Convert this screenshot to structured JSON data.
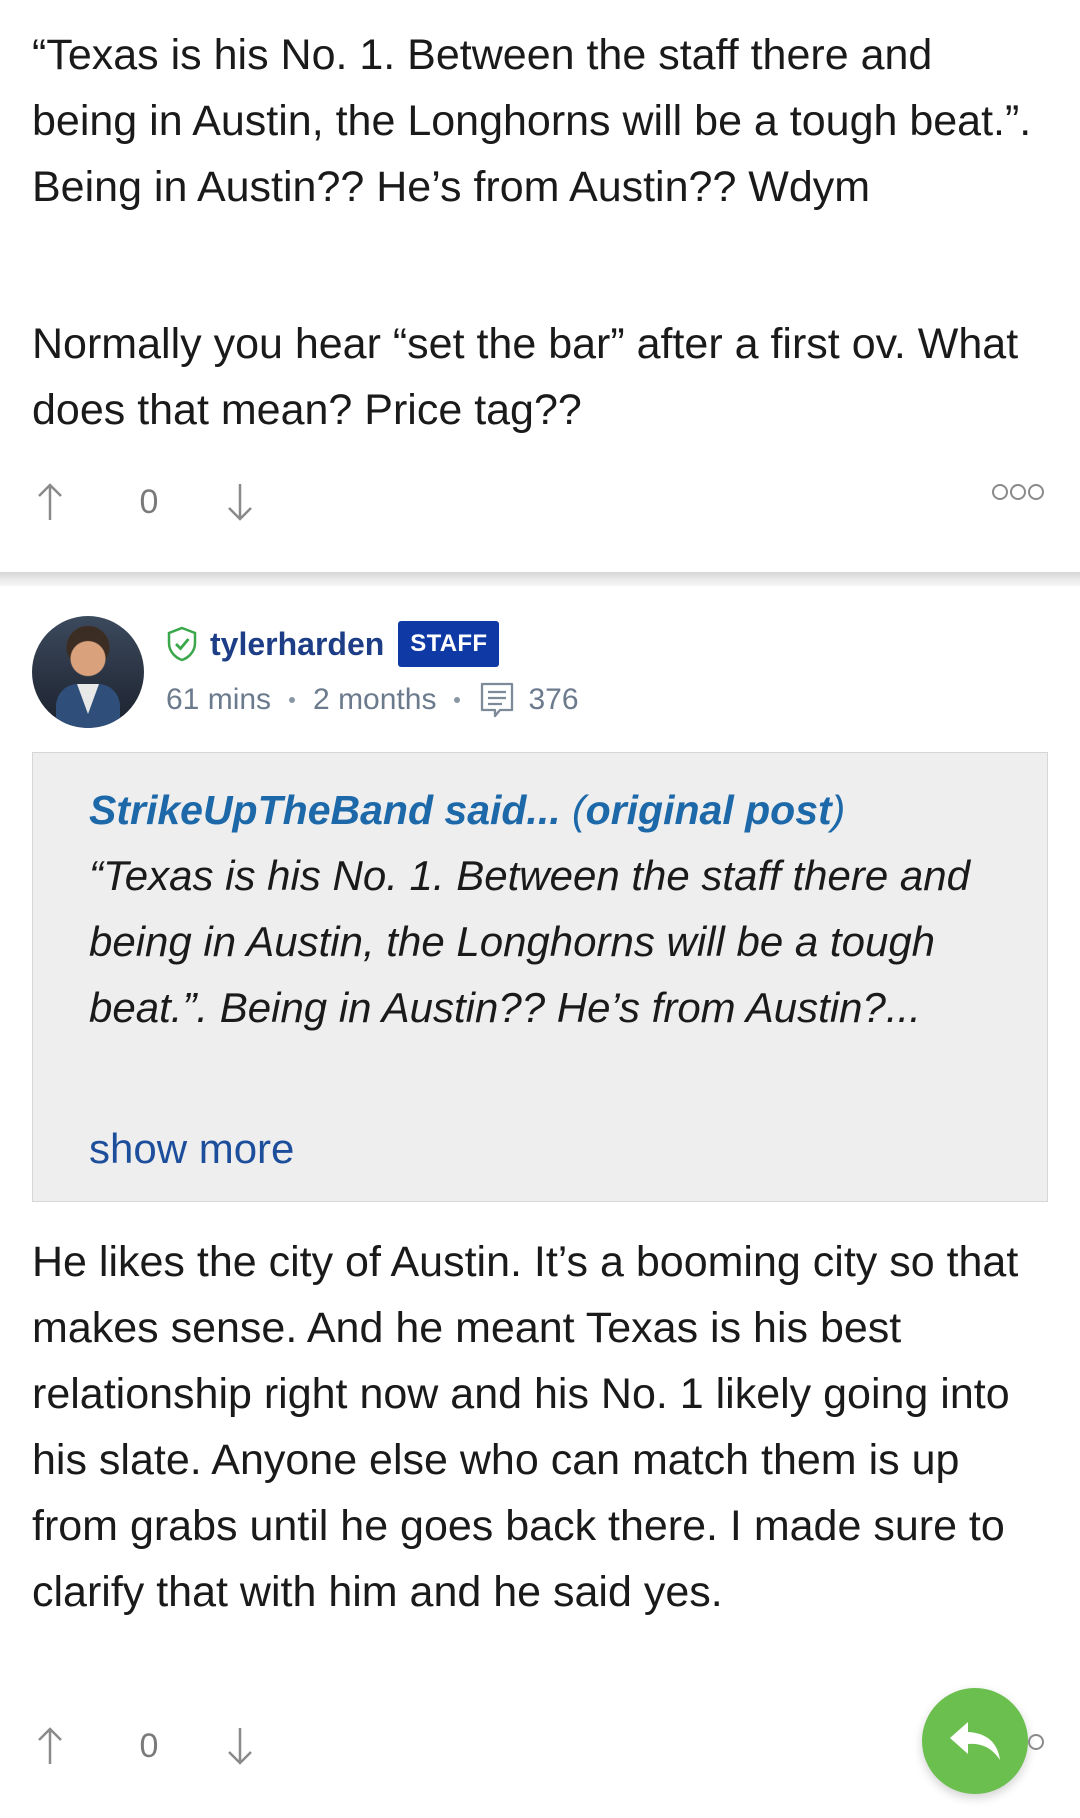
{
  "previous_post": {
    "paragraphs": [
      "“Texas is his No. 1. Between the staff there and being in Austin, the Longhorns will be a tough beat.”. Being in Austin?? He’s from Austin?? Wdym",
      "Normally you hear “set the bar” after a first ov. What does that mean? Price tag??"
    ],
    "vote_count": "0",
    "icons": {
      "upvote": "upvote-arrow-icon",
      "downvote": "downvote-arrow-icon",
      "more": "more-options-icon"
    }
  },
  "reply_post": {
    "author": {
      "username": "tylerharden",
      "badge": "STAFF",
      "verified_icon": "shield-check-icon",
      "avatar_icon": "avatar"
    },
    "meta": {
      "posted": "61 mins",
      "member_since": "2 months",
      "post_count": "376",
      "post_count_icon": "comment-icon"
    },
    "quote": {
      "author_said": "StrikeUpTheBand said...",
      "paren_open": " (",
      "link_label": "original post",
      "paren_close": ")",
      "text": "“Texas is his No. 1. Between the staff there and being in Austin, the Longhorns will be a tough beat.”. Being in Austin?? He’s from Austin?...",
      "show_more_label": "show more"
    },
    "body": "He likes the city of Austin. It’s a booming city so that makes sense. And he meant Texas is his best relationship right now and his No. 1 likely going into his slate. Anyone else who can match them is up from grabs until he goes back there. I made sure to clarify that with him and he said yes.",
    "vote_count": "0"
  },
  "colors": {
    "username": "#1d3d86",
    "staff_badge": "#0f3aa6",
    "quote_link": "#1c68a8",
    "show_more": "#1c4e9b",
    "reply_button": "#6bbf4e",
    "meta_text": "#6b7a8c"
  }
}
